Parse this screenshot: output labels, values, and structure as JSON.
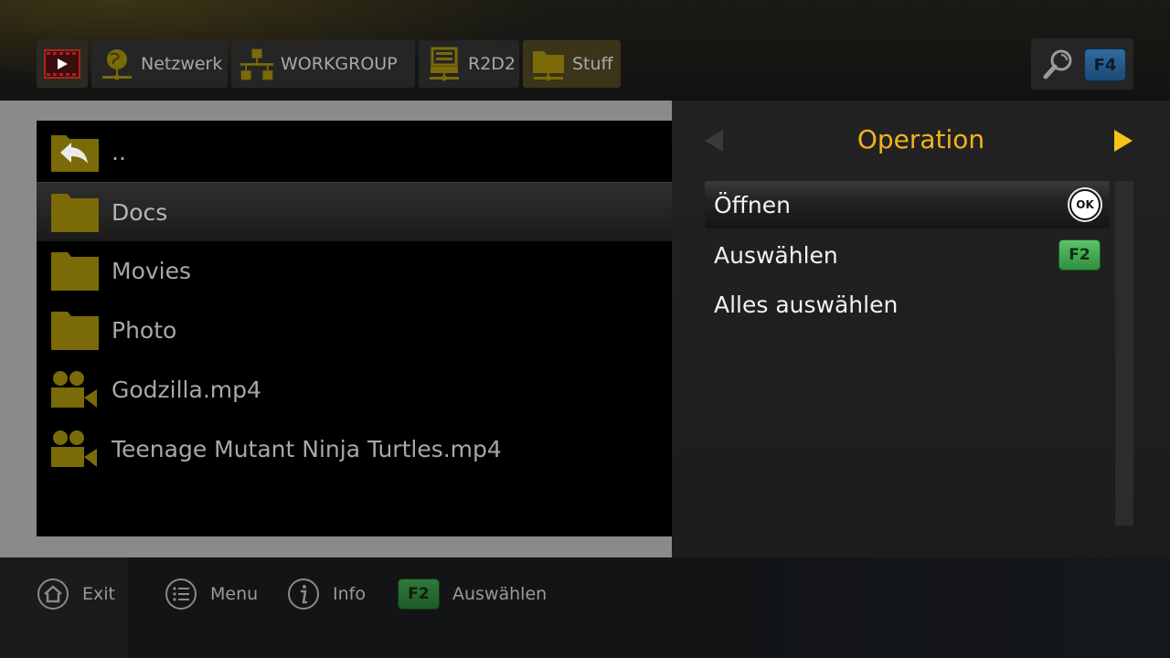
{
  "breadcrumbs": [
    {
      "icon": "video-icon",
      "label": ""
    },
    {
      "icon": "globe-network-icon",
      "label": "Netzwerk"
    },
    {
      "icon": "network-tree-icon",
      "label": "WORKGROUP"
    },
    {
      "icon": "computer-icon",
      "label": "R2D2"
    },
    {
      "icon": "shared-folder-icon",
      "label": "Stuff"
    }
  ],
  "search": {
    "key_label": "F4"
  },
  "files": [
    {
      "icon": "back-arrow-icon",
      "name": ".."
    },
    {
      "icon": "folder-icon",
      "name": "Docs",
      "selected": true
    },
    {
      "icon": "folder-icon",
      "name": "Movies"
    },
    {
      "icon": "folder-icon",
      "name": "Photo"
    },
    {
      "icon": "video-camera-icon",
      "name": "Godzilla.mp4"
    },
    {
      "icon": "video-camera-icon",
      "name": "Teenage Mutant Ninja Turtles.mp4"
    }
  ],
  "operation_panel": {
    "title": "Operation",
    "items": [
      {
        "label": "Öffnen",
        "key": "OK"
      },
      {
        "label": "Auswählen",
        "key": "F2"
      },
      {
        "label": "Alles auswählen",
        "key": ""
      }
    ]
  },
  "footer": {
    "exit_label": "Exit",
    "menu_label": "Menu",
    "info_label": "Info",
    "f2_key": "F2",
    "select_label": "Auswählen"
  },
  "colors": {
    "accent": "#f0b41e",
    "icon_gold": "#7a6a08",
    "f2_green": "#3fae4f",
    "f4_blue": "#2a5f92"
  }
}
